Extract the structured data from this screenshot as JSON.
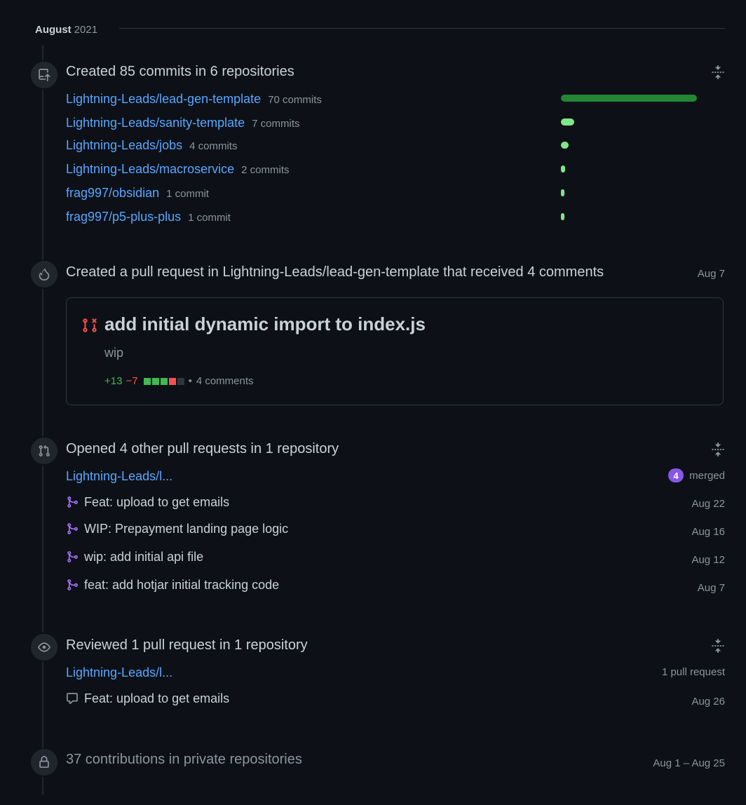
{
  "month": {
    "name": "August",
    "year": "2021"
  },
  "commits_section": {
    "heading": "Created 85 commits in 6 repositories",
    "repos": [
      {
        "name": "Lightning-Leads/lead-gen-template",
        "count": "70 commits",
        "share": 1.0
      },
      {
        "name": "Lightning-Leads/sanity-template",
        "count": "7 commits",
        "share": 0.1
      },
      {
        "name": "Lightning-Leads/jobs",
        "count": "4 commits",
        "share": 0.057
      },
      {
        "name": "Lightning-Leads/macroservice",
        "count": "2 commits",
        "share": 0.029
      },
      {
        "name": "frag997/obsidian",
        "count": "1 commit",
        "share": 0.014
      },
      {
        "name": "frag997/p5-plus-plus",
        "count": "1 commit",
        "share": 0.014
      }
    ]
  },
  "pr_created_section": {
    "heading": "Created a pull request in Lightning-Leads/lead-gen-template that received 4 comments",
    "date": "Aug 7",
    "card": {
      "title": "add initial dynamic import to index.js",
      "body": "wip",
      "additions": "+13",
      "deletions": "−7",
      "comments": "4 comments"
    }
  },
  "opened_section": {
    "heading": "Opened 4 other pull requests in 1 repository",
    "repo": "Lightning-Leads/l...",
    "merged_count": "4",
    "merged_label": "merged",
    "items": [
      {
        "title": "Feat: upload to get emails",
        "date": "Aug 22"
      },
      {
        "title": "WIP: Prepayment landing page logic",
        "date": "Aug 16"
      },
      {
        "title": "wip: add initial api file",
        "date": "Aug 12"
      },
      {
        "title": "feat: add hotjar initial tracking code",
        "date": "Aug 7"
      }
    ]
  },
  "reviewed_section": {
    "heading": "Reviewed 1 pull request in 1 repository",
    "repo": "Lightning-Leads/l...",
    "summary": "1 pull request",
    "items": [
      {
        "title": "Feat: upload to get emails",
        "date": "Aug 26"
      }
    ]
  },
  "private_section": {
    "text": "37 contributions in private repositories",
    "date_range": "Aug 1 – Aug 25"
  },
  "colors": {
    "bar_main": "#238636",
    "bar_light": "#7ee787",
    "merged": "#8957e5",
    "link": "#58a6ff"
  }
}
